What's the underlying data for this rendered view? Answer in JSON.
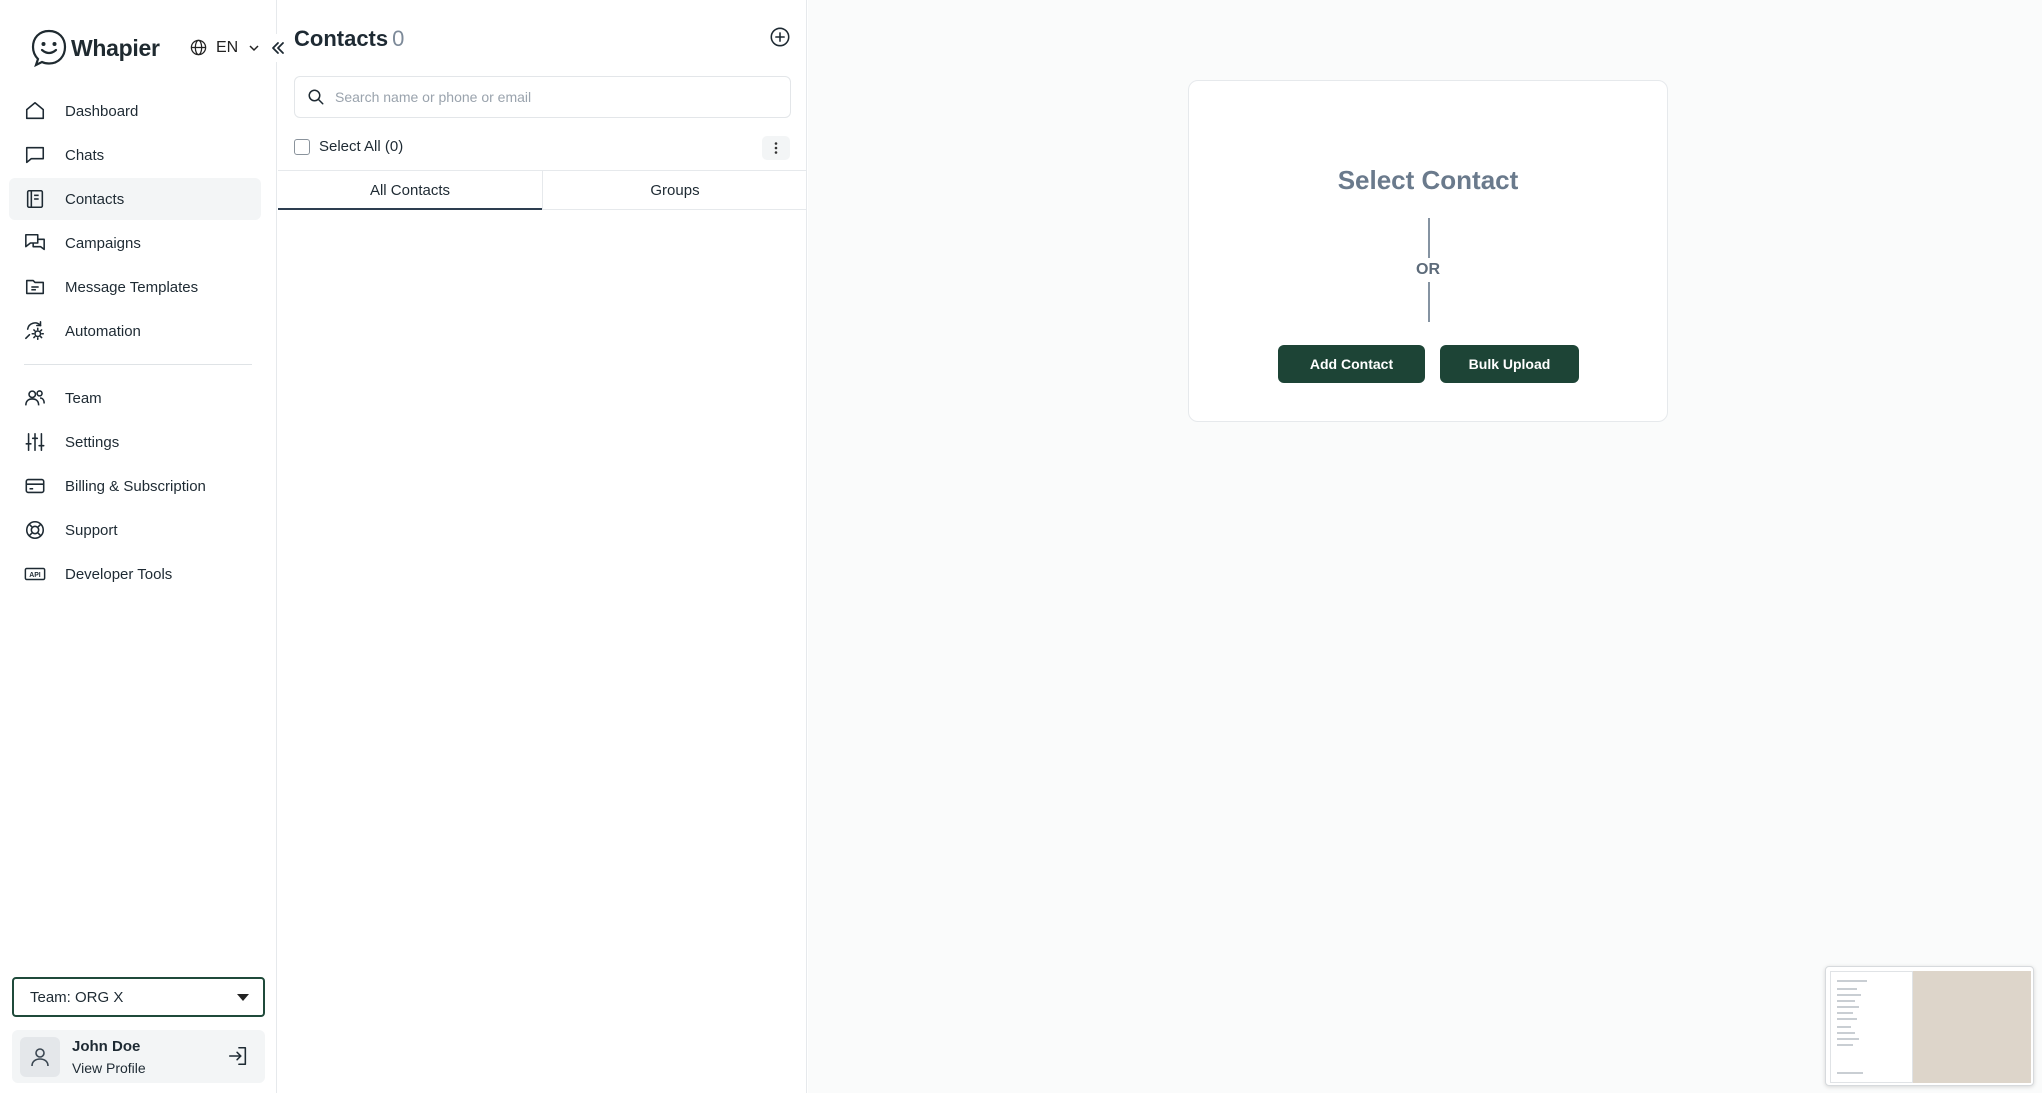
{
  "brand": {
    "name": "Whapier",
    "accent": "#1d4436"
  },
  "language": {
    "code": "EN"
  },
  "sidebar": {
    "items": [
      {
        "label": "Dashboard",
        "icon": "home-icon",
        "active": false
      },
      {
        "label": "Chats",
        "icon": "chat-bubble-icon",
        "active": false
      },
      {
        "label": "Contacts",
        "icon": "contacts-book-icon",
        "active": true
      },
      {
        "label": "Campaigns",
        "icon": "campaign-chat-icon",
        "active": false
      },
      {
        "label": "Message Templates",
        "icon": "folder-template-icon",
        "active": false
      },
      {
        "label": "Automation",
        "icon": "automation-gear-icon",
        "active": false
      }
    ],
    "items_secondary": [
      {
        "label": "Team",
        "icon": "team-icon"
      },
      {
        "label": "Settings",
        "icon": "sliders-icon"
      },
      {
        "label": "Billing & Subscription",
        "icon": "credit-card-icon"
      },
      {
        "label": "Support",
        "icon": "lifebuoy-icon"
      },
      {
        "label": "Developer Tools",
        "icon": "api-icon"
      }
    ],
    "team_select": "Team: ORG X",
    "profile": {
      "name": "John Doe",
      "link": "View Profile"
    }
  },
  "contacts": {
    "title": "Contacts",
    "count": "0",
    "search_placeholder": "Search name or phone or email",
    "select_all_label": "Select All (0)",
    "tabs": [
      {
        "label": "All Contacts",
        "active": true
      },
      {
        "label": "Groups",
        "active": false
      }
    ]
  },
  "detail": {
    "title": "Select Contact",
    "or_label": "OR",
    "add_contact_label": "Add Contact",
    "bulk_upload_label": "Bulk Upload"
  }
}
